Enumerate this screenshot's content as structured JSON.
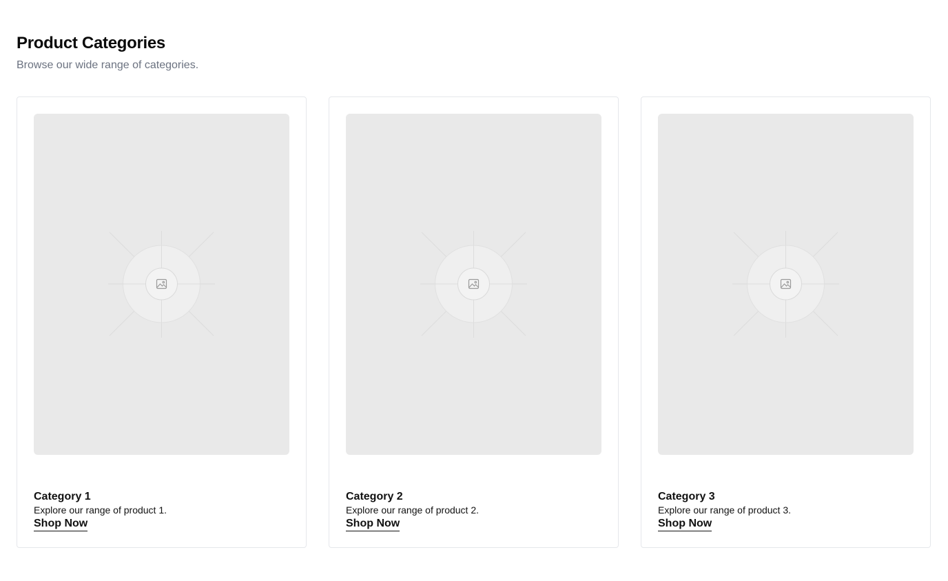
{
  "header": {
    "title": "Product Categories",
    "subtitle": "Browse our wide range of categories."
  },
  "categories": [
    {
      "title": "Category 1",
      "description": "Explore our range of product 1.",
      "link_label": "Shop Now",
      "image_icon": "image-placeholder-icon"
    },
    {
      "title": "Category 2",
      "description": "Explore our range of product 2.",
      "link_label": "Shop Now",
      "image_icon": "image-placeholder-icon"
    },
    {
      "title": "Category 3",
      "description": "Explore our range of product 3.",
      "link_label": "Shop Now",
      "image_icon": "image-placeholder-icon"
    }
  ],
  "colors": {
    "placeholder_bg": "#e9e9e9",
    "card_border": "#e5e7eb",
    "subtitle": "#6b7280",
    "text": "#111111"
  }
}
